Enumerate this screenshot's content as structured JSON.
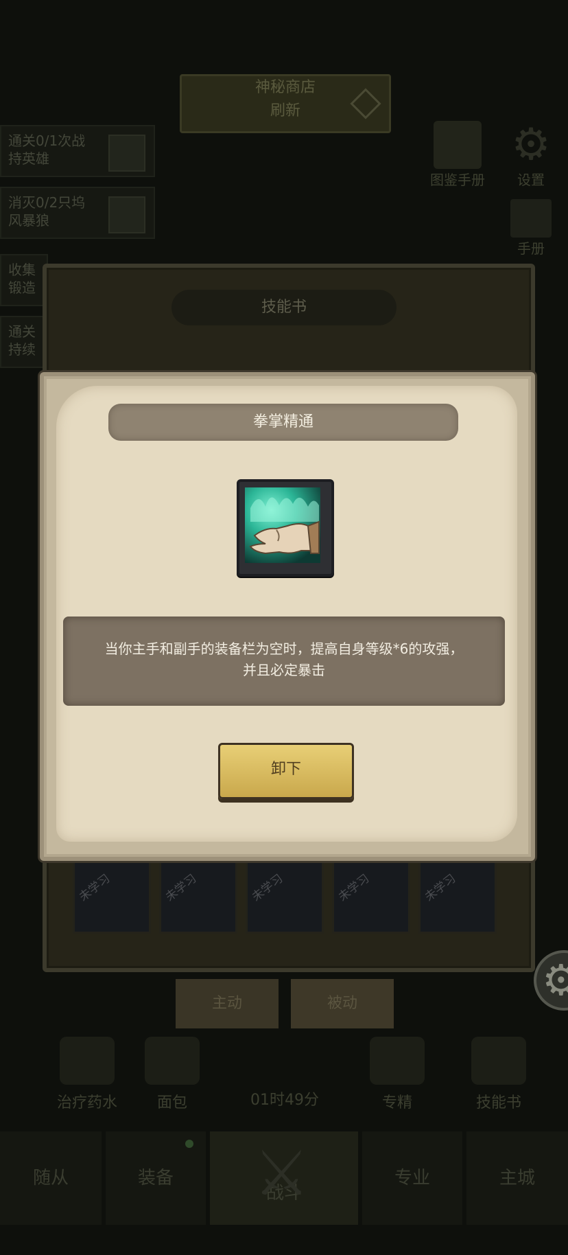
{
  "background": {
    "top_banner": {
      "line1": "神秘商店",
      "line2": "刷新"
    },
    "quests": [
      {
        "text": "通关0/1次战\n持英雄"
      },
      {
        "text": "消灭0/2只坞\n风暴狼"
      },
      {
        "text": "收集\n锻造"
      },
      {
        "text": "通关\n持续"
      }
    ],
    "top_right": {
      "handbook_label": "图鉴手册",
      "settings_label": "设置",
      "other_label": "手册"
    },
    "skill_book_title": "技能书",
    "skill_slots": [
      {
        "tag": "未学习"
      },
      {
        "tag": "未学习"
      },
      {
        "tag": "未学习"
      },
      {
        "tag": "未学习"
      },
      {
        "tag": "未学习"
      }
    ],
    "tabs": {
      "active": "主动",
      "passive": "被动"
    },
    "items": [
      {
        "label": "治疗药水"
      },
      {
        "label": "面包"
      },
      {
        "label": "专精"
      },
      {
        "label": "技能书"
      }
    ],
    "timer": "01时49分",
    "nav": [
      {
        "label": "随从"
      },
      {
        "label": "装备"
      },
      {
        "label": "战斗"
      },
      {
        "label": "专业"
      },
      {
        "label": "主城"
      }
    ]
  },
  "dialog": {
    "title": "拳掌精通",
    "skill_icon": "fist-mastery-icon",
    "description_line1": "当你主手和副手的装备栏为空时，提高自身等级*6的攻强，",
    "description_line2": "并且必定暴击",
    "unequip_label": "卸下"
  },
  "colors": {
    "parchment": "#e5dac1",
    "title_band": "#8f8371",
    "description_box": "#7d7162",
    "button_gold": "#e0c46a",
    "overlay": "#0e100c"
  }
}
